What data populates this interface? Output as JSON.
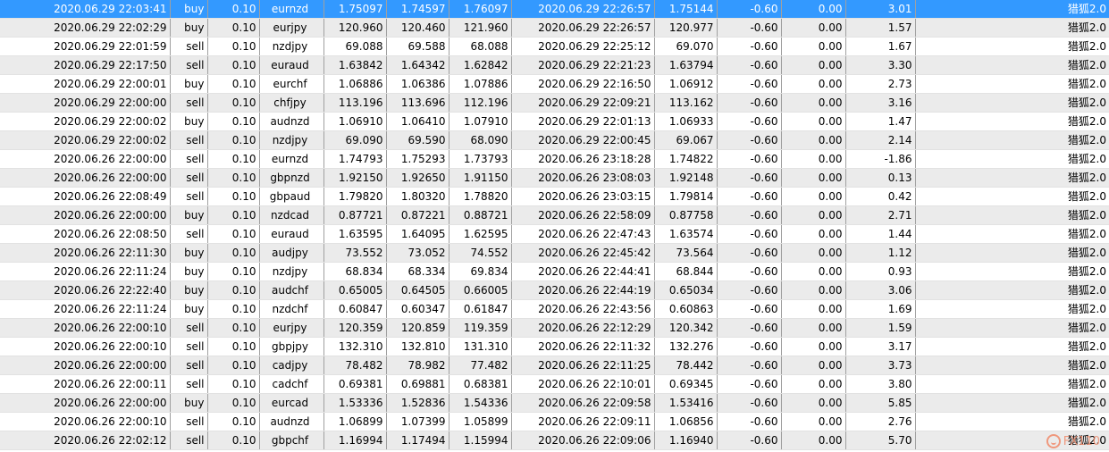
{
  "table": {
    "selected_row": 0,
    "rows": [
      [
        "2020.06.29 22:03:41",
        "buy",
        "0.10",
        "eurnzd",
        "1.75097",
        "1.74597",
        "1.76097",
        "2020.06.29 22:26:57",
        "1.75144",
        "-0.60",
        "0.00",
        "3.01",
        "猎狐2.0"
      ],
      [
        "2020.06.29 22:02:29",
        "buy",
        "0.10",
        "eurjpy",
        "120.960",
        "120.460",
        "121.960",
        "2020.06.29 22:26:57",
        "120.977",
        "-0.60",
        "0.00",
        "1.57",
        "猎狐2.0"
      ],
      [
        "2020.06.29 22:01:59",
        "sell",
        "0.10",
        "nzdjpy",
        "69.088",
        "69.588",
        "68.088",
        "2020.06.29 22:25:12",
        "69.070",
        "-0.60",
        "0.00",
        "1.67",
        "猎狐2.0"
      ],
      [
        "2020.06.29 22:17:50",
        "sell",
        "0.10",
        "euraud",
        "1.63842",
        "1.64342",
        "1.62842",
        "2020.06.29 22:21:23",
        "1.63794",
        "-0.60",
        "0.00",
        "3.30",
        "猎狐2.0"
      ],
      [
        "2020.06.29 22:00:01",
        "buy",
        "0.10",
        "eurchf",
        "1.06886",
        "1.06386",
        "1.07886",
        "2020.06.29 22:16:50",
        "1.06912",
        "-0.60",
        "0.00",
        "2.73",
        "猎狐2.0"
      ],
      [
        "2020.06.29 22:00:00",
        "sell",
        "0.10",
        "chfjpy",
        "113.196",
        "113.696",
        "112.196",
        "2020.06.29 22:09:21",
        "113.162",
        "-0.60",
        "0.00",
        "3.16",
        "猎狐2.0"
      ],
      [
        "2020.06.29 22:00:02",
        "buy",
        "0.10",
        "audnzd",
        "1.06910",
        "1.06410",
        "1.07910",
        "2020.06.29 22:01:13",
        "1.06933",
        "-0.60",
        "0.00",
        "1.47",
        "猎狐2.0"
      ],
      [
        "2020.06.29 22:00:02",
        "sell",
        "0.10",
        "nzdjpy",
        "69.090",
        "69.590",
        "68.090",
        "2020.06.29 22:00:45",
        "69.067",
        "-0.60",
        "0.00",
        "2.14",
        "猎狐2.0"
      ],
      [
        "2020.06.26 22:00:00",
        "sell",
        "0.10",
        "eurnzd",
        "1.74793",
        "1.75293",
        "1.73793",
        "2020.06.26 23:18:28",
        "1.74822",
        "-0.60",
        "0.00",
        "-1.86",
        "猎狐2.0"
      ],
      [
        "2020.06.26 22:00:00",
        "sell",
        "0.10",
        "gbpnzd",
        "1.92150",
        "1.92650",
        "1.91150",
        "2020.06.26 23:08:03",
        "1.92148",
        "-0.60",
        "0.00",
        "0.13",
        "猎狐2.0"
      ],
      [
        "2020.06.26 22:08:49",
        "sell",
        "0.10",
        "gbpaud",
        "1.79820",
        "1.80320",
        "1.78820",
        "2020.06.26 23:03:15",
        "1.79814",
        "-0.60",
        "0.00",
        "0.42",
        "猎狐2.0"
      ],
      [
        "2020.06.26 22:00:00",
        "buy",
        "0.10",
        "nzdcad",
        "0.87721",
        "0.87221",
        "0.88721",
        "2020.06.26 22:58:09",
        "0.87758",
        "-0.60",
        "0.00",
        "2.71",
        "猎狐2.0"
      ],
      [
        "2020.06.26 22:08:50",
        "sell",
        "0.10",
        "euraud",
        "1.63595",
        "1.64095",
        "1.62595",
        "2020.06.26 22:47:43",
        "1.63574",
        "-0.60",
        "0.00",
        "1.44",
        "猎狐2.0"
      ],
      [
        "2020.06.26 22:11:30",
        "buy",
        "0.10",
        "audjpy",
        "73.552",
        "73.052",
        "74.552",
        "2020.06.26 22:45:42",
        "73.564",
        "-0.60",
        "0.00",
        "1.12",
        "猎狐2.0"
      ],
      [
        "2020.06.26 22:11:24",
        "buy",
        "0.10",
        "nzdjpy",
        "68.834",
        "68.334",
        "69.834",
        "2020.06.26 22:44:41",
        "68.844",
        "-0.60",
        "0.00",
        "0.93",
        "猎狐2.0"
      ],
      [
        "2020.06.26 22:22:40",
        "buy",
        "0.10",
        "audchf",
        "0.65005",
        "0.64505",
        "0.66005",
        "2020.06.26 22:44:19",
        "0.65034",
        "-0.60",
        "0.00",
        "3.06",
        "猎狐2.0"
      ],
      [
        "2020.06.26 22:11:24",
        "buy",
        "0.10",
        "nzdchf",
        "0.60847",
        "0.60347",
        "0.61847",
        "2020.06.26 22:43:56",
        "0.60863",
        "-0.60",
        "0.00",
        "1.69",
        "猎狐2.0"
      ],
      [
        "2020.06.26 22:00:10",
        "sell",
        "0.10",
        "eurjpy",
        "120.359",
        "120.859",
        "119.359",
        "2020.06.26 22:12:29",
        "120.342",
        "-0.60",
        "0.00",
        "1.59",
        "猎狐2.0"
      ],
      [
        "2020.06.26 22:00:10",
        "sell",
        "0.10",
        "gbpjpy",
        "132.310",
        "132.810",
        "131.310",
        "2020.06.26 22:11:32",
        "132.276",
        "-0.60",
        "0.00",
        "3.17",
        "猎狐2.0"
      ],
      [
        "2020.06.26 22:00:00",
        "sell",
        "0.10",
        "cadjpy",
        "78.482",
        "78.982",
        "77.482",
        "2020.06.26 22:11:25",
        "78.442",
        "-0.60",
        "0.00",
        "3.73",
        "猎狐2.0"
      ],
      [
        "2020.06.26 22:00:11",
        "sell",
        "0.10",
        "cadchf",
        "0.69381",
        "0.69881",
        "0.68381",
        "2020.06.26 22:10:01",
        "0.69345",
        "-0.60",
        "0.00",
        "3.80",
        "猎狐2.0"
      ],
      [
        "2020.06.26 22:00:00",
        "buy",
        "0.10",
        "eurcad",
        "1.53336",
        "1.52836",
        "1.54336",
        "2020.06.26 22:09:58",
        "1.53416",
        "-0.60",
        "0.00",
        "5.85",
        "猎狐2.0"
      ],
      [
        "2020.06.26 22:00:10",
        "sell",
        "0.10",
        "audnzd",
        "1.06899",
        "1.07399",
        "1.05899",
        "2020.06.26 22:09:11",
        "1.06856",
        "-0.60",
        "0.00",
        "2.76",
        "猎狐2.0"
      ],
      [
        "2020.06.26 22:02:12",
        "sell",
        "0.10",
        "gbpchf",
        "1.16994",
        "1.17494",
        "1.15994",
        "2020.06.26 22:09:06",
        "1.16940",
        "-0.60",
        "0.00",
        "5.70",
        "猎狐2.0"
      ]
    ]
  },
  "watermark": {
    "icon": "fxbook-logo-icon",
    "text": "FX110"
  },
  "colors": {
    "selected": "#3399ff",
    "alt_row": "#ebebeb",
    "grid_line": "#a0a0a0"
  }
}
